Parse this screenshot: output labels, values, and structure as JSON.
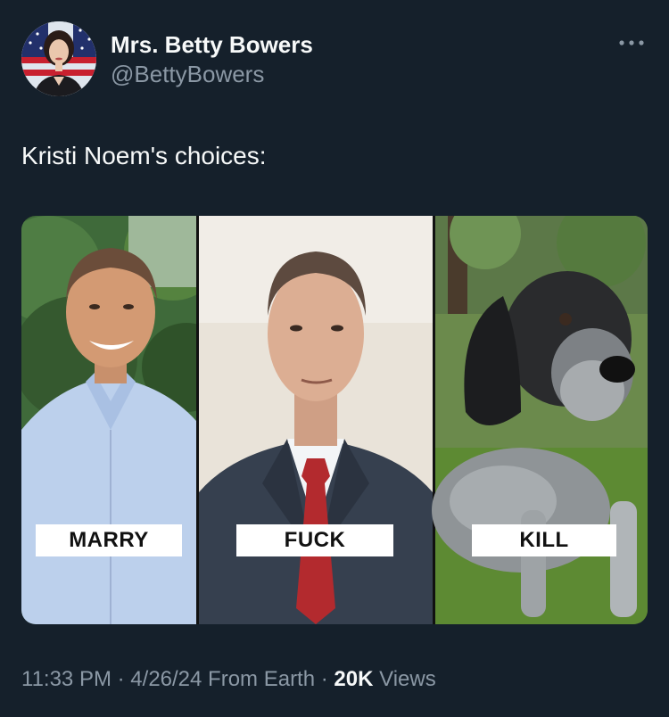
{
  "author": {
    "display_name": "Mrs. Betty Bowers",
    "handle": "@BettyBowers",
    "avatar_icon": "portrait-avatar-icon"
  },
  "more_icon": "more-options-icon",
  "tweet": {
    "text": "Kristi Noem's choices:"
  },
  "media": {
    "panels": [
      {
        "label": "MARRY",
        "subject": "smiling man in light blue shirt"
      },
      {
        "label": "FUCK",
        "subject": "man in suit with red tie"
      },
      {
        "label": "KILL",
        "subject": "grey and black dog lying in grass"
      }
    ]
  },
  "meta": {
    "time": "11:33 PM",
    "separator": "·",
    "date": "4/26/24",
    "source": "From Earth",
    "views_count": "20K",
    "views_label": "Views"
  },
  "colors": {
    "background": "#15202b",
    "primary_text": "#f7f9f9",
    "secondary_text": "#8b98a5"
  }
}
